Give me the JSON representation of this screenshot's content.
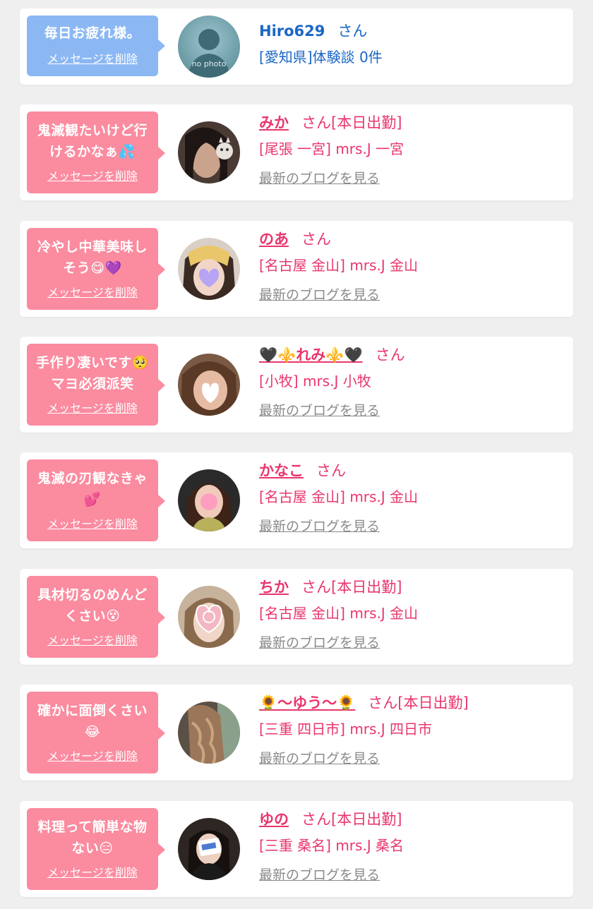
{
  "items": [
    {
      "message": "毎日お疲れ様。",
      "delete_label": "メッセージを削除",
      "name": "Hiro629",
      "suffix": "さん",
      "line2": "[愛知県]体験談 0件",
      "blog": "",
      "avatar_text": "no photo"
    },
    {
      "message": "鬼滅観たいけど行けるかなぁ💦",
      "delete_label": "メッセージを削除",
      "name": "みか",
      "suffix": "さん[本日出勤]",
      "line2": "[尾張 一宮] mrs.J 一宮",
      "blog": "最新のブログを見る"
    },
    {
      "message": "冷やし中華美味しそう😋💜",
      "delete_label": "メッセージを削除",
      "name": "のあ",
      "suffix": "さん",
      "line2": "[名古屋 金山] mrs.J 金山",
      "blog": "最新のブログを見る"
    },
    {
      "message": "手作り凄いです🥺マヨ必須派笑",
      "delete_label": "メッセージを削除",
      "name": "🖤⚜️れみ⚜️🖤",
      "suffix": "さん",
      "line2": "[小牧] mrs.J 小牧",
      "blog": "最新のブログを見る"
    },
    {
      "message": "鬼滅の刃観なきゃ💕",
      "delete_label": "メッセージを削除",
      "name": "かなこ",
      "suffix": "さん",
      "line2": "[名古屋 金山] mrs.J 金山",
      "blog": "最新のブログを見る"
    },
    {
      "message": "具材切るのめんどくさい😵",
      "delete_label": "メッセージを削除",
      "name": "ちか",
      "suffix": "さん[本日出勤]",
      "line2": "[名古屋 金山] mrs.J 金山",
      "blog": "最新のブログを見る"
    },
    {
      "message": "確かに面倒くさい😂",
      "delete_label": "メッセージを削除",
      "name": "🌻〜ゆう〜🌻",
      "suffix": "さん[本日出勤]",
      "line2": "[三重 四日市] mrs.J 四日市",
      "blog": "最新のブログを見る"
    },
    {
      "message": "料理って簡単な物ない😑",
      "delete_label": "メッセージを削除",
      "name": "ゆの",
      "suffix": "さん[本日出勤]",
      "line2": "[三重 桑名] mrs.J 桑名",
      "blog": "最新のブログを見る"
    }
  ],
  "colors": {
    "pink_bubble": "#fb8b9f",
    "blue_bubble": "#8bb8f3",
    "name_pink": "#e9366c",
    "name_blue": "#1a66c6",
    "link_gray": "#8a8a8a"
  }
}
